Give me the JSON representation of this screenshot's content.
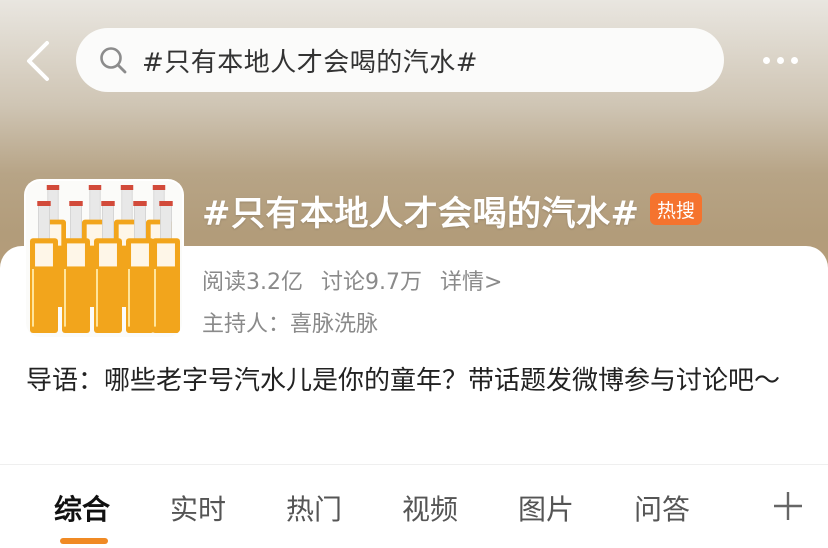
{
  "header": {
    "search_text": "#只有本地人才会喝的汽水#"
  },
  "topic": {
    "title": "#只有本地人才会喝的汽水#",
    "hot_badge": "热搜",
    "reads": "阅读3.2亿",
    "discussions": "讨论9.7万",
    "details_link": "详情>",
    "host_label": "主持人：",
    "host_name": "喜脉洗脉",
    "intro": "导语：哪些老字号汽水儿是你的童年？带话题发微博参与讨论吧～"
  },
  "tabs": [
    {
      "label": "综合",
      "active": true
    },
    {
      "label": "实时",
      "active": false
    },
    {
      "label": "热门",
      "active": false
    },
    {
      "label": "视频",
      "active": false
    },
    {
      "label": "图片",
      "active": false
    },
    {
      "label": "问答",
      "active": false
    }
  ],
  "colors": {
    "accent": "#f08a24",
    "hot_badge": "#f5732e",
    "bottle_liquid": "#f2a51c"
  },
  "icons": {
    "back": "chevron-left-icon",
    "search": "search-icon",
    "more": "more-dots-icon",
    "add_tab": "plus-icon"
  }
}
